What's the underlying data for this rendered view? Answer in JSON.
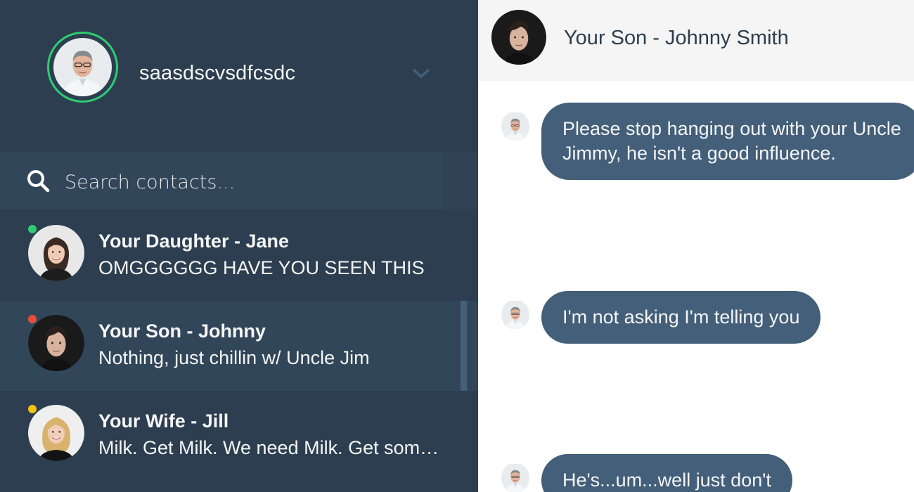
{
  "profile": {
    "name": "saasdscvsdfcsdc",
    "status_color": "#2ecc71",
    "menu_icon": "chevron-down-icon"
  },
  "search": {
    "placeholder": "Search contacts...",
    "icon": "search-icon"
  },
  "contacts": [
    {
      "name": "Your Daughter - Jane",
      "preview": "OMGGGGGG HAVE YOU SEEN THIS",
      "status_color": "#2ecc71",
      "active": false
    },
    {
      "name": "Your Son - Johnny",
      "preview": "Nothing, just chillin w/ Uncle Jim",
      "status_color": "#e74c3c",
      "active": true
    },
    {
      "name": "Your Wife - Jill",
      "preview": "Milk. Get Milk. We need Milk. Get some Milk.",
      "status_color": "#f1c40f",
      "active": false
    }
  ],
  "chat": {
    "contact_name": "Your Son - Johnny Smith",
    "messages": [
      {
        "line1": "Please stop hanging out with your Uncle",
        "line2": "Jimmy, he isn't a good influence."
      },
      {
        "line1": "I'm not asking I'm telling you",
        "line2": ""
      },
      {
        "line1": "He's...um...well just don't",
        "line2": ""
      }
    ]
  },
  "colors": {
    "sidebar_bg": "#2c3e50",
    "search_bg": "#32465a",
    "bubble_bg": "#435f7a",
    "header_bg": "#f5f5f5"
  }
}
